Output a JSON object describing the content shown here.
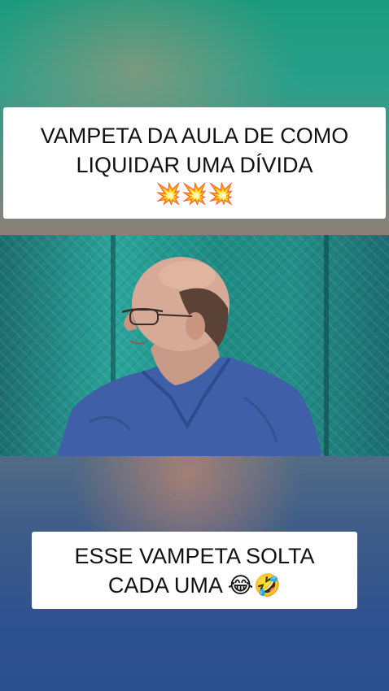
{
  "captions": {
    "top": {
      "line1": "VAMPETA DA AULA DE COMO",
      "line2": "LIQUIDAR UMA DÍVIDA",
      "emoji": "💥💥💥"
    },
    "bottom": {
      "line1": "ESSE VAMPETA SOLTA",
      "line2": "CADA UMA 😂🤣"
    }
  },
  "colors": {
    "caption_bg": "#ffffff",
    "caption_text": "#111111",
    "shirt": "#3f5fa8",
    "backdrop_teal": "#2aa59b"
  },
  "icons": [
    "collision-emoji",
    "tears-of-joy-emoji",
    "rolling-laughing-emoji"
  ]
}
